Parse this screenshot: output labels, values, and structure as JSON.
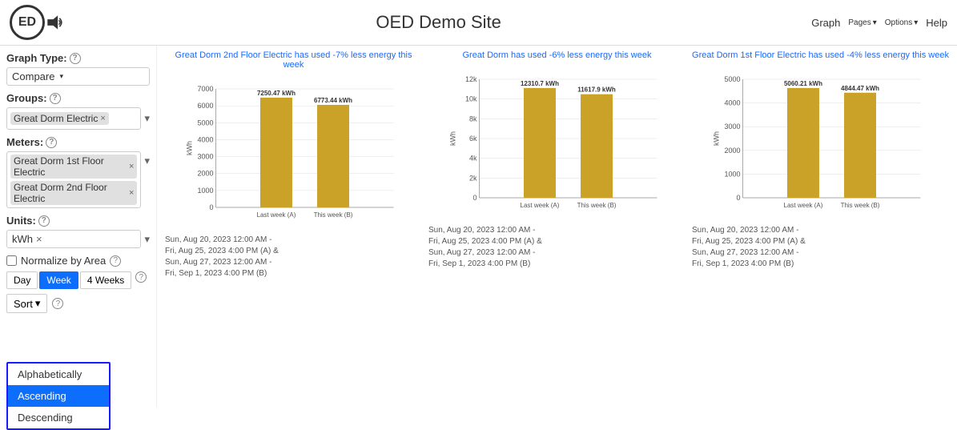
{
  "header": {
    "logo_text": "ED",
    "title": "OED Demo Site",
    "nav": {
      "graph": "Graph",
      "pages": "Pages",
      "options": "Options",
      "help": "Help"
    }
  },
  "sidebar": {
    "graph_type_label": "Graph Type:",
    "graph_type_value": "Compare",
    "groups_label": "Groups:",
    "groups_tag": "Great Dorm Electric",
    "meters_label": "Meters:",
    "meter1": "Great Dorm 1st Floor Electric",
    "meter2": "Great Dorm 2nd Floor Electric",
    "units_label": "Units:",
    "units_value": "kWh",
    "normalize_label": "Normalize by Area",
    "time_buttons": [
      "Day",
      "Week",
      "4 Weeks"
    ],
    "active_time": "Week",
    "sort_label": "Sort",
    "sort_options": [
      "Alphabetically",
      "Ascending",
      "Descending"
    ],
    "selected_sort": "Ascending"
  },
  "charts": [
    {
      "subtitle": "Great Dorm 2nd Floor Electric  has used -7% less energy this week",
      "bar1_label": "7250.47 kWh",
      "bar2_label": "6773.44 kWh",
      "bar1_value": 7250.47,
      "bar2_value": 6773.44,
      "max_value": 7000,
      "x_label1": "Last week (A)",
      "x_label2": "This week (B)",
      "y_ticks": [
        "0",
        "1000",
        "2000",
        "3000",
        "4000",
        "5000",
        "6000",
        "7000"
      ],
      "y_label": "kWh",
      "footer": "Sun, Aug 20, 2023 12:00 AM -\nFri, Aug 25, 2023 4:00 PM (A) &\nSun, Aug 27, 2023 12:00 AM -\nFri, Sep 1, 2023 4:00 PM (B)"
    },
    {
      "subtitle": "Great Dorm  has used -6% less energy this week",
      "bar1_label": "12310.7 kWh",
      "bar2_label": "11617.9 kWh",
      "bar1_value": 12310.7,
      "bar2_value": 11617.9,
      "max_value": 12000,
      "x_label1": "Last week (A)",
      "x_label2": "This week (B)",
      "y_ticks": [
        "0",
        "2k",
        "4k",
        "6k",
        "8k",
        "10k",
        "12k"
      ],
      "y_label": "kWh",
      "footer": "Sun, Aug 20, 2023 12:00 AM -\nFri, Aug 25, 2023 4:00 PM (A) &\nSun, Aug 27, 2023 12:00 AM -\nFri, Sep 1, 2023 4:00 PM (B)"
    },
    {
      "subtitle": "Great Dorm 1st Floor Electric  has used -4% less energy this week",
      "bar1_label": "5060.21 kWh",
      "bar2_label": "4844.47 kWh",
      "bar1_value": 5060.21,
      "bar2_value": 4844.47,
      "max_value": 5000,
      "x_label1": "Last week (A)",
      "x_label2": "This week (B)",
      "y_ticks": [
        "0",
        "1000",
        "2000",
        "3000",
        "4000",
        "5000"
      ],
      "y_label": "kWh",
      "footer": "Sun, Aug 20, 2023 12:00 AM -\nFri, Aug 25, 2023 4:00 PM (A) &\nSun, Aug 27, 2023 12:00 AM -\nFri, Sep 1, 2023 4:00 PM (B)"
    }
  ],
  "colors": {
    "bar": "#C9A227",
    "bar_hover": "#b08f20",
    "accent": "#0d6efd",
    "subtitle_link": "#1a6aff"
  }
}
